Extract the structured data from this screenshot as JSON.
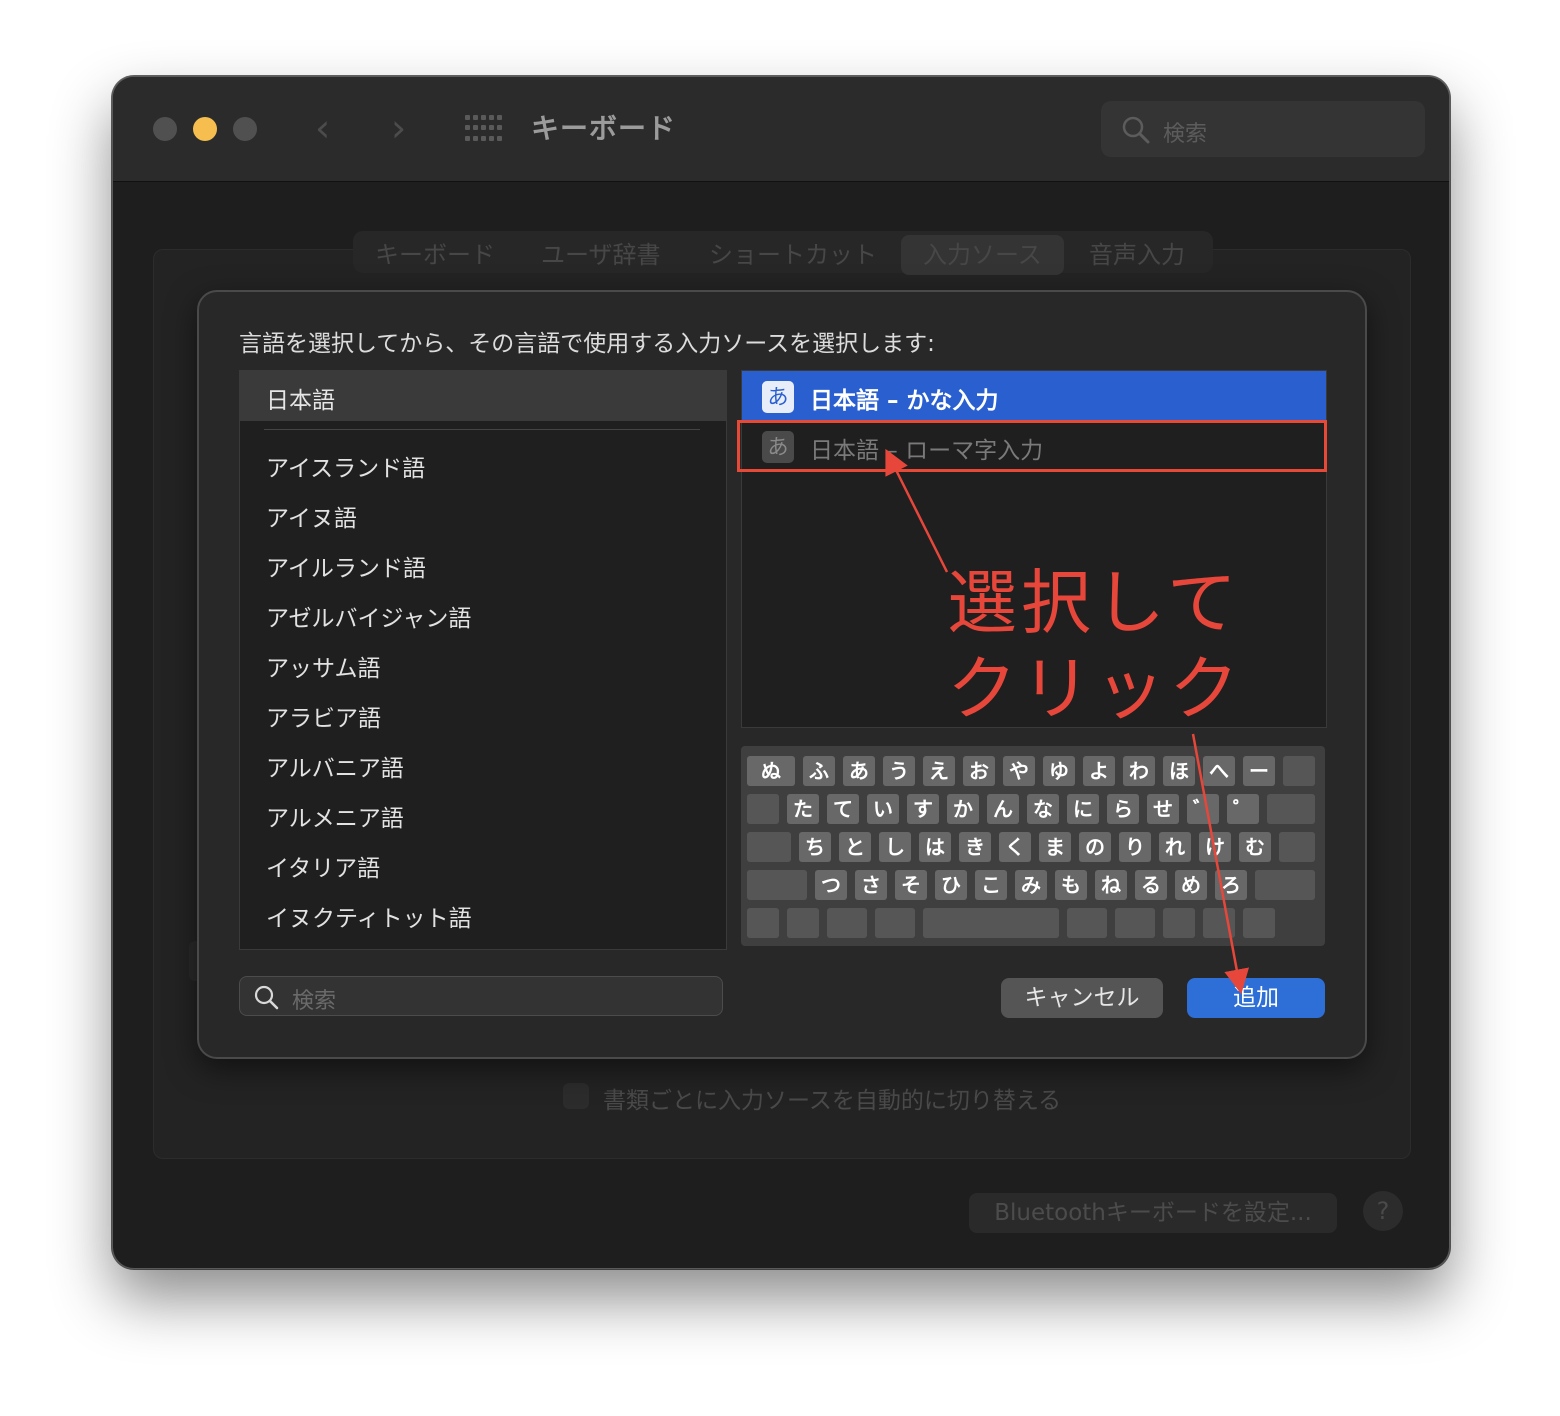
{
  "window": {
    "title": "キーボード",
    "search_placeholder": "検索",
    "traffic_lights": {
      "close_color": "#505050",
      "minimize_color": "#f5be4f",
      "maximize_color": "#505050"
    }
  },
  "tabs": [
    {
      "label": "キーボード",
      "active": false
    },
    {
      "label": "ユーザ辞書",
      "active": false
    },
    {
      "label": "ショートカット",
      "active": false
    },
    {
      "label": "入力ソース",
      "active": true
    },
    {
      "label": "音声入力",
      "active": false
    }
  ],
  "background": {
    "auto_switch_label": "書類ごとに入力ソースを自動的に切り替える",
    "bluetooth_button": "Bluetoothキーボードを設定...",
    "help_button": "?"
  },
  "sheet": {
    "prompt": "言語を選択してから、その言語で使用する入力ソースを選択します:",
    "languages": {
      "selected": "日本語",
      "items": [
        "アイスランド語",
        "アイヌ語",
        "アイルランド語",
        "アゼルバイジャン語",
        "アッサム語",
        "アラビア語",
        "アルバニア語",
        "アルメニア語",
        "イタリア語",
        "イヌクティトット語"
      ]
    },
    "sources": [
      {
        "icon_glyph": "あ",
        "label": "日本語 – かな入力",
        "selected": true
      },
      {
        "icon_glyph": "あ",
        "label": "日本語 – ローマ字入力",
        "selected": false
      }
    ],
    "keyboard_rows": [
      [
        "ぬ",
        "ふ",
        "あ",
        "う",
        "え",
        "お",
        "や",
        "ゆ",
        "よ",
        "わ",
        "ほ",
        "へ",
        "ー",
        ""
      ],
      [
        "",
        "た",
        "て",
        "い",
        "す",
        "か",
        "ん",
        "な",
        "に",
        "ら",
        "せ",
        "゛",
        "゜",
        ""
      ],
      [
        "",
        "ち",
        "と",
        "し",
        "は",
        "き",
        "く",
        "ま",
        "の",
        "り",
        "れ",
        "け",
        "む",
        ""
      ],
      [
        "",
        "つ",
        "さ",
        "そ",
        "ひ",
        "こ",
        "み",
        "も",
        "ね",
        "る",
        "め",
        "ろ",
        ""
      ],
      [
        "",
        "",
        "",
        "",
        "",
        "",
        "",
        "",
        "",
        ""
      ]
    ],
    "search_placeholder": "検索",
    "cancel_button": "キャンセル",
    "add_button": "追加"
  },
  "annotation": {
    "line1": "選択して",
    "line2": "クリック",
    "color": "#e6473a"
  }
}
